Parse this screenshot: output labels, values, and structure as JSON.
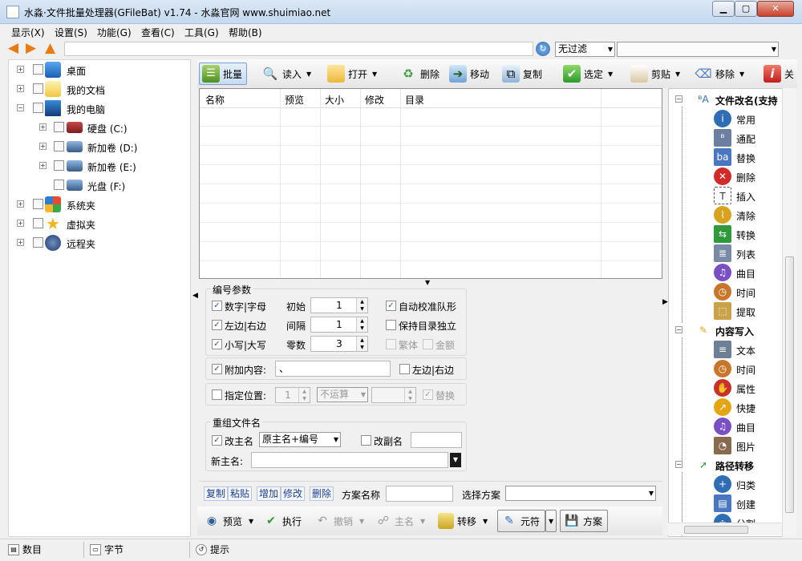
{
  "window": {
    "title": "水淼·文件批量处理器(GFileBat) v1.74 - 水淼官网 www.shuimiao.net",
    "controls": {
      "minimize": "▁",
      "maximize": "▢",
      "close": "✕"
    }
  },
  "menu": [
    "显示(X)",
    "设置(S)",
    "功能(G)",
    "查看(C)",
    "工具(G)",
    "帮助(B)"
  ],
  "address": {
    "path": "",
    "filter_selected": "无过滤",
    "filter_combo_value": ""
  },
  "tree": [
    {
      "label": "桌面",
      "icon": "desktop-icon"
    },
    {
      "label": "我的文档",
      "icon": "documents-folder-icon"
    },
    {
      "label": "我的电脑",
      "icon": "computer-icon"
    },
    {
      "label": "硬盘 (C:)",
      "icon": "hard-drive-icon"
    },
    {
      "label": "新加卷 (D:)",
      "icon": "hard-drive-icon"
    },
    {
      "label": "新加卷 (E:)",
      "icon": "hard-drive-icon"
    },
    {
      "label": "光盘 (F:)",
      "icon": "optical-drive-icon"
    },
    {
      "label": "系统夹",
      "icon": "system-folder-icon"
    },
    {
      "label": "虚拟夹",
      "icon": "star-icon"
    },
    {
      "label": "远程夹",
      "icon": "ftp-icon"
    }
  ],
  "toolbar": {
    "batch": "批量",
    "read": "读入",
    "open": "打开",
    "delete": "删除",
    "move": "移动",
    "copy": "复制",
    "select": "选定",
    "cut": "剪贴",
    "remove": "移除",
    "close": "关"
  },
  "grid": {
    "columns": [
      "名称",
      "预览",
      "大小",
      "修改",
      "目录"
    ]
  },
  "numbering": {
    "title": "编号参数",
    "digits_letters": "数字|字母",
    "start_label": "初始",
    "start_value": "1",
    "auto_align": "自动校准队形",
    "left_right": "左边|右边",
    "interval_label": "间隔",
    "interval_value": "1",
    "keep_dir_independent": "保持目录独立",
    "lower_upper": "小写|大写",
    "zeros_label": "零数",
    "zeros_value": "3",
    "traditional": "繁体",
    "amount": "金额"
  },
  "append": {
    "label": "附加内容:",
    "value": "、",
    "left_right": "左边|右边"
  },
  "position": {
    "label": "指定位置:",
    "value": "1",
    "op": "不运算",
    "extra": "",
    "replace": "替换"
  },
  "regroup": {
    "title": "重组文件名",
    "change_main": "改主名",
    "main_mode": "原主名+编号",
    "change_ext": "改副名",
    "ext_value": "",
    "new_main_label": "新主名:",
    "new_main_value": ""
  },
  "scheme": {
    "copy": "复制",
    "paste": "粘贴",
    "add": "增加",
    "modify": "修改",
    "delete": "删除",
    "name_label": "方案名称",
    "name_value": "",
    "choose_label": "选择方案",
    "choose_value": ""
  },
  "bottom": {
    "preview": "预览",
    "execute": "执行",
    "undo": "撤销",
    "main_name": "主名",
    "transfer": "转移",
    "meta": "元符",
    "scheme": "方案"
  },
  "right_panel": {
    "groups": [
      {
        "label": "文件改名(支持",
        "icon": "rename-icon",
        "items": [
          {
            "label": "常用",
            "icon": "info-icon",
            "color": "#2f6db5"
          },
          {
            "label": "通配",
            "icon": "wildcard-icon",
            "color": "#6b7fa0"
          },
          {
            "label": "替换",
            "icon": "replace-icon",
            "color": "#4a78c0"
          },
          {
            "label": "删除",
            "icon": "delete-x-icon",
            "color": "#d22a2a"
          },
          {
            "label": "插入",
            "icon": "insert-text-icon",
            "color": "#555555"
          },
          {
            "label": "清除",
            "icon": "broom-icon",
            "color": "#d9a21d"
          },
          {
            "label": "转换",
            "icon": "convert-icon",
            "color": "#2e9a3c"
          },
          {
            "label": "列表",
            "icon": "list-icon",
            "color": "#7a8aa6"
          },
          {
            "label": "曲目",
            "icon": "music-icon",
            "color": "#7a4fc4"
          },
          {
            "label": "时间",
            "icon": "clock-icon",
            "color": "#c8772a"
          },
          {
            "label": "提取",
            "icon": "extract-icon",
            "color": "#c9a24a"
          }
        ]
      },
      {
        "label": "内容写入",
        "icon": "pencil-icon",
        "items": [
          {
            "label": "文本",
            "icon": "text-doc-icon",
            "color": "#6f7f95"
          },
          {
            "label": "时间",
            "icon": "clock-icon",
            "color": "#c8772a"
          },
          {
            "label": "属性",
            "icon": "hand-icon",
            "color": "#c9302a"
          },
          {
            "label": "快捷",
            "icon": "shortcut-icon",
            "color": "#e5a513"
          },
          {
            "label": "曲目",
            "icon": "music-icon",
            "color": "#7a4fc4"
          },
          {
            "label": "图片",
            "icon": "eye-picture-icon",
            "color": "#8a6a4f"
          }
        ]
      },
      {
        "label": "路径转移",
        "icon": "path-arrow-icon",
        "items": [
          {
            "label": "归类",
            "icon": "classify-icon",
            "color": "#2f6db5"
          },
          {
            "label": "创建",
            "icon": "create-doc-icon",
            "color": "#4a78c0"
          },
          {
            "label": "分割",
            "icon": "split-icon",
            "color": "#2f6db5"
          }
        ]
      }
    ]
  },
  "status": {
    "count": "数目",
    "chars": "字节",
    "hint": "提示"
  },
  "colors": {
    "title_bar": "#c4d8ee",
    "accent": "#2f6db5",
    "close_red": "#c7412c"
  }
}
